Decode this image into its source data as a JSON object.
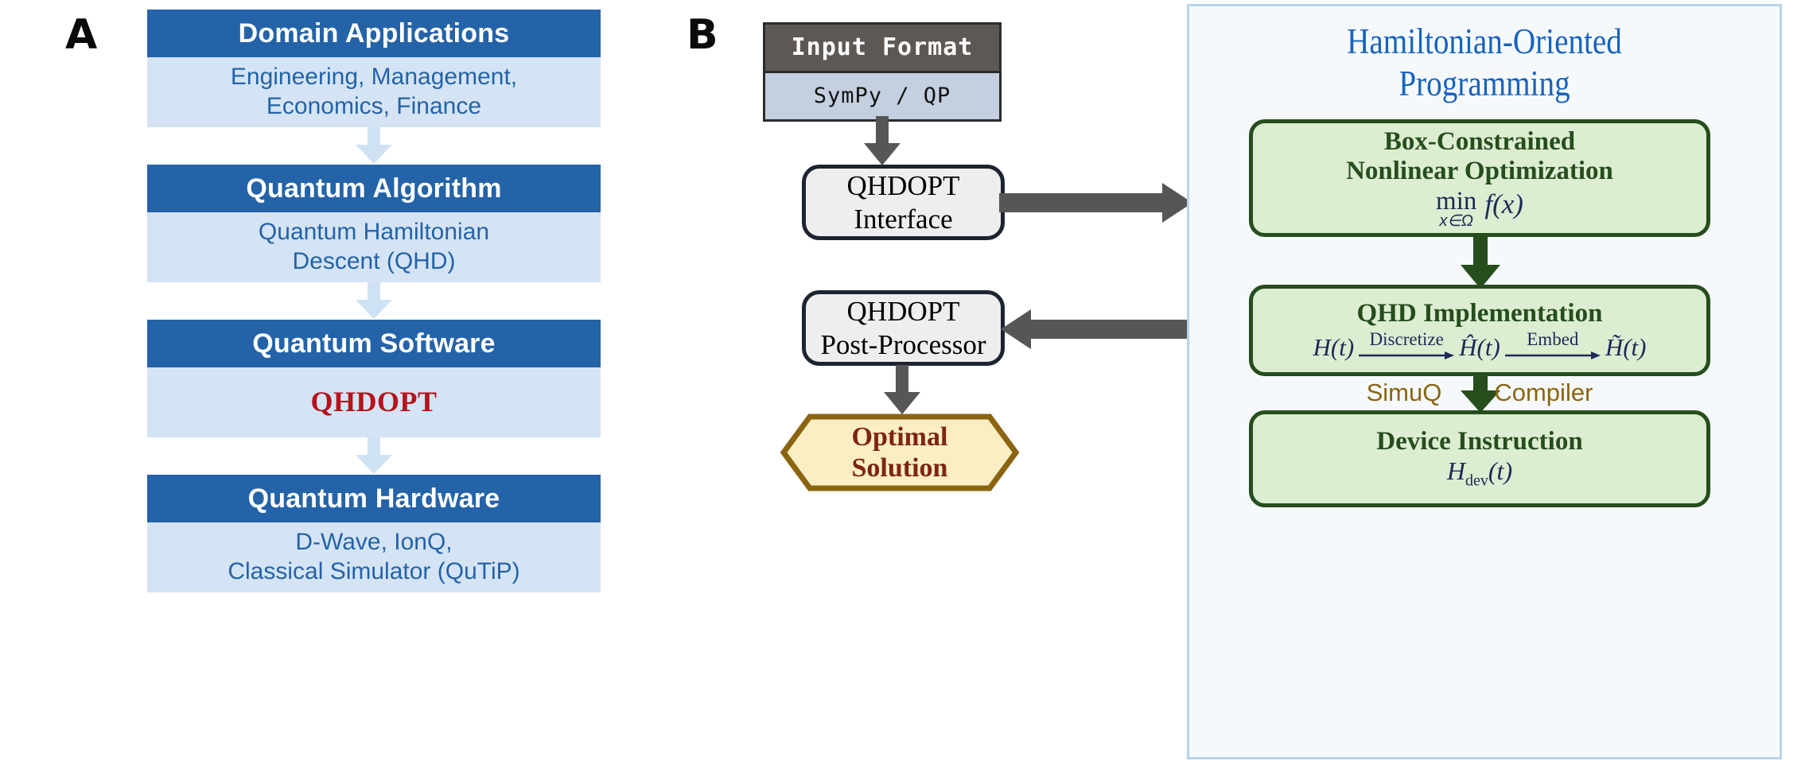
{
  "figure": {
    "panel_a_letter": "A",
    "panel_b_letter": "B"
  },
  "panel_a": {
    "cards": [
      {
        "title": "Domain Applications",
        "body_line1": "Engineering, Management,",
        "body_line2": "Economics, Finance"
      },
      {
        "title": "Quantum Algorithm",
        "body_line1": "Quantum Hamiltonian",
        "body_line2": "Descent (QHD)"
      },
      {
        "title": "Quantum Software",
        "body_line1": "QHDOPT",
        "body_line2": ""
      },
      {
        "title": "Quantum Hardware",
        "body_line1": "D-Wave, IonQ,",
        "body_line2": "Classical Simulator (QuTiP)"
      }
    ],
    "arrow_icon": "down-arrow-icon"
  },
  "panel_b": {
    "input_format": {
      "header": "Input Format",
      "body": "SymPy / QP"
    },
    "interface_box": {
      "line1": "QHDOPT",
      "line2": "Interface"
    },
    "post_processor_box": {
      "line1": "QHDOPT",
      "line2": "Post-Processor"
    },
    "optimal_solution": {
      "line1": "Optimal",
      "line2": "Solution"
    },
    "arrows": {
      "input_to_interface": "down-arrow-icon",
      "interface_to_hop": "right-arrow-icon",
      "hop_to_post": "left-arrow-icon",
      "post_to_solution": "down-arrow-icon"
    }
  },
  "hop_panel": {
    "title_line1": "Hamiltonian-Oriented",
    "title_line2": "Programming",
    "box_box_constrained": {
      "title_line1": "Box-Constrained",
      "title_line2": "Nonlinear Optimization",
      "formula_operator": "min",
      "formula_subscript": "x∈Ω",
      "formula_objective": "f(x)"
    },
    "box_qhd_implementation": {
      "title": "QHD Implementation",
      "term1": "H(t)",
      "label1": "Discretize",
      "term2": "Ĥ(t)",
      "label2": "Embed",
      "term3": "H̃(t)"
    },
    "compiler_label_left": "SimuQ",
    "compiler_label_right": "Compiler",
    "box_device_instruction": {
      "title": "Device Instruction",
      "formula_base": "H",
      "formula_sub": "dev",
      "formula_arg": "(t)"
    },
    "arrows": {
      "bc_to_qhd": "down-arrow-icon",
      "qhd_to_device": "down-arrow-icon"
    }
  },
  "colors": {
    "panel_a_header_blue": "#2463a8",
    "panel_a_body_blue": "#d4e4f4",
    "panel_a_arrow_blue": "#cfe2f3",
    "qhdopt_red": "#b5121b",
    "input_header_grey": "#5e5854",
    "input_body_grey_blue": "#c4cfe0",
    "box_border_dark": "#1d2330",
    "grey_arrow": "#565656",
    "hexagon_fill": "#fbeec4",
    "hexagon_border": "#8a6410",
    "hexagon_text": "#7d2510",
    "hop_panel_bg": "#f6f9fc",
    "hop_panel_border": "#b6d4ea",
    "hop_title_blue": "#1763bd",
    "green_box_fill": "#dcedd2",
    "green_box_border": "#264d1c",
    "math_navy": "#1b2a56",
    "compiler_gold": "#8a6410"
  }
}
